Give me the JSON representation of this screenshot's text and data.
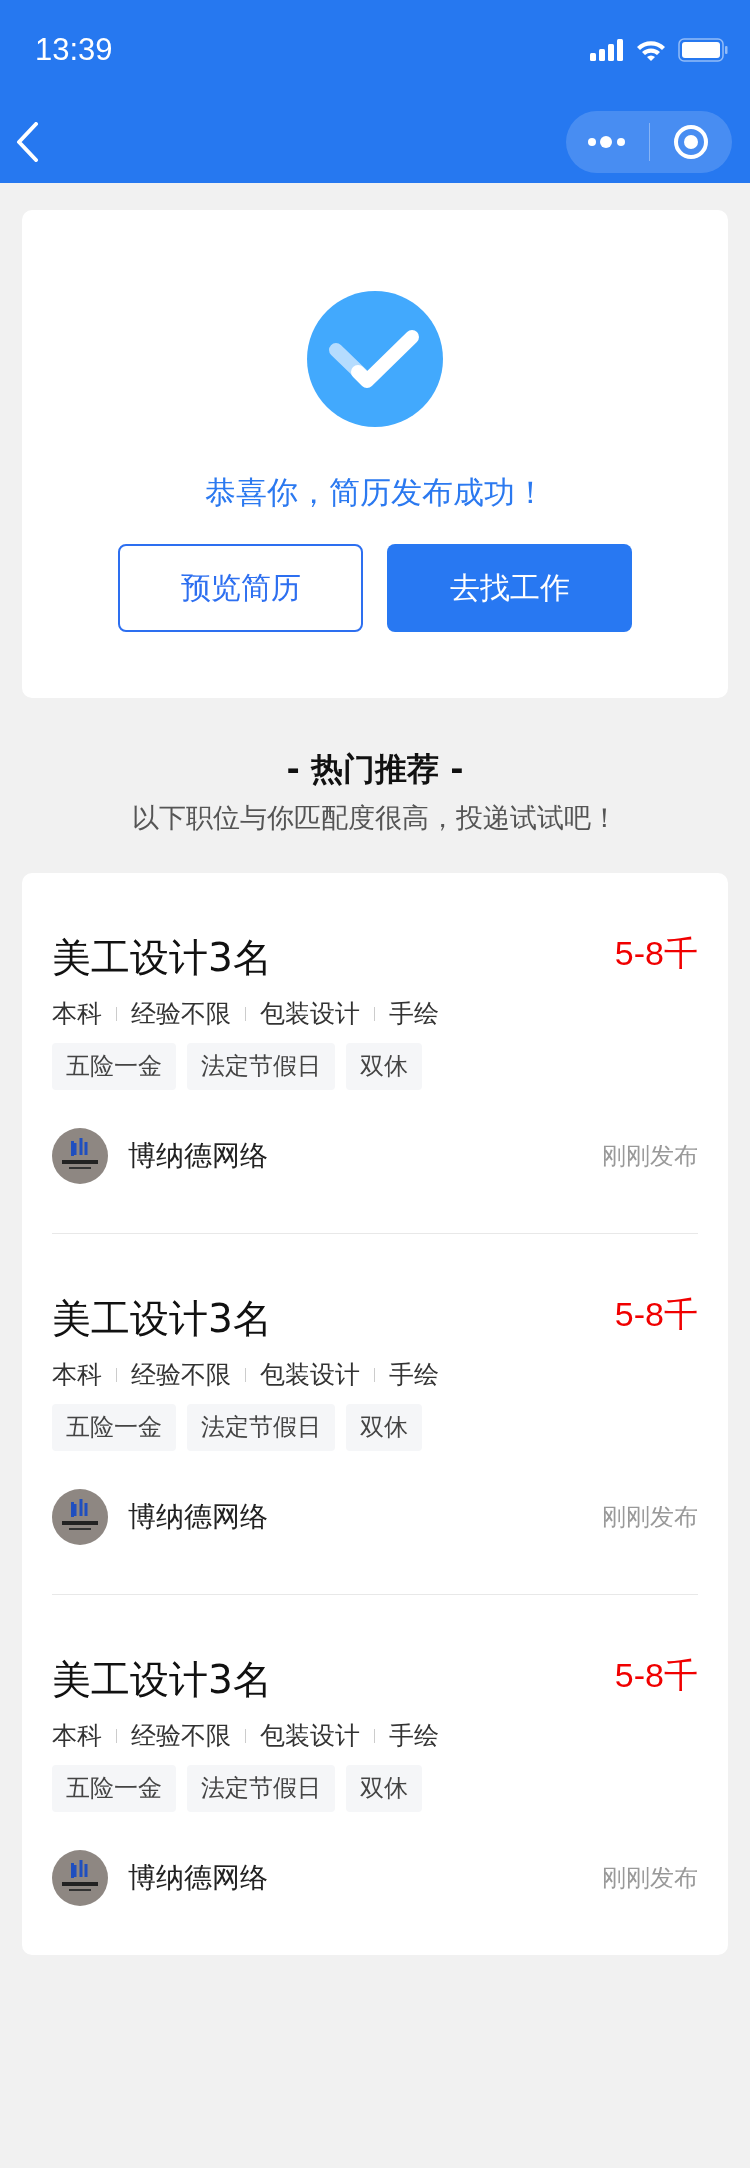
{
  "status_bar": {
    "time": "13:39"
  },
  "success": {
    "message": "恭喜你，简历发布成功！",
    "buttons": [
      {
        "label": "预览简历",
        "kind": "outline"
      },
      {
        "label": "去找工作",
        "kind": "primary"
      }
    ]
  },
  "recommend": {
    "title": "- 热门推荐 -",
    "subtitle": "以下职位与你匹配度很高，投递试试吧！"
  },
  "jobs": [
    {
      "title": "美工设计3名",
      "salary": "5-8千",
      "meta": [
        "本科",
        "经验不限",
        "包装设计",
        "手绘"
      ],
      "tags": [
        "五险一金",
        "法定节假日",
        "双休"
      ],
      "company": "博纳德网络",
      "posted": "刚刚发布"
    },
    {
      "title": "美工设计3名",
      "salary": "5-8千",
      "meta": [
        "本科",
        "经验不限",
        "包装设计",
        "手绘"
      ],
      "tags": [
        "五险一金",
        "法定节假日",
        "双休"
      ],
      "company": "博纳德网络",
      "posted": "刚刚发布"
    },
    {
      "title": "美工设计3名",
      "salary": "5-8千",
      "meta": [
        "本科",
        "经验不限",
        "包装设计",
        "手绘"
      ],
      "tags": [
        "五险一金",
        "法定节假日",
        "双休"
      ],
      "company": "博纳德网络",
      "posted": "刚刚发布"
    }
  ]
}
